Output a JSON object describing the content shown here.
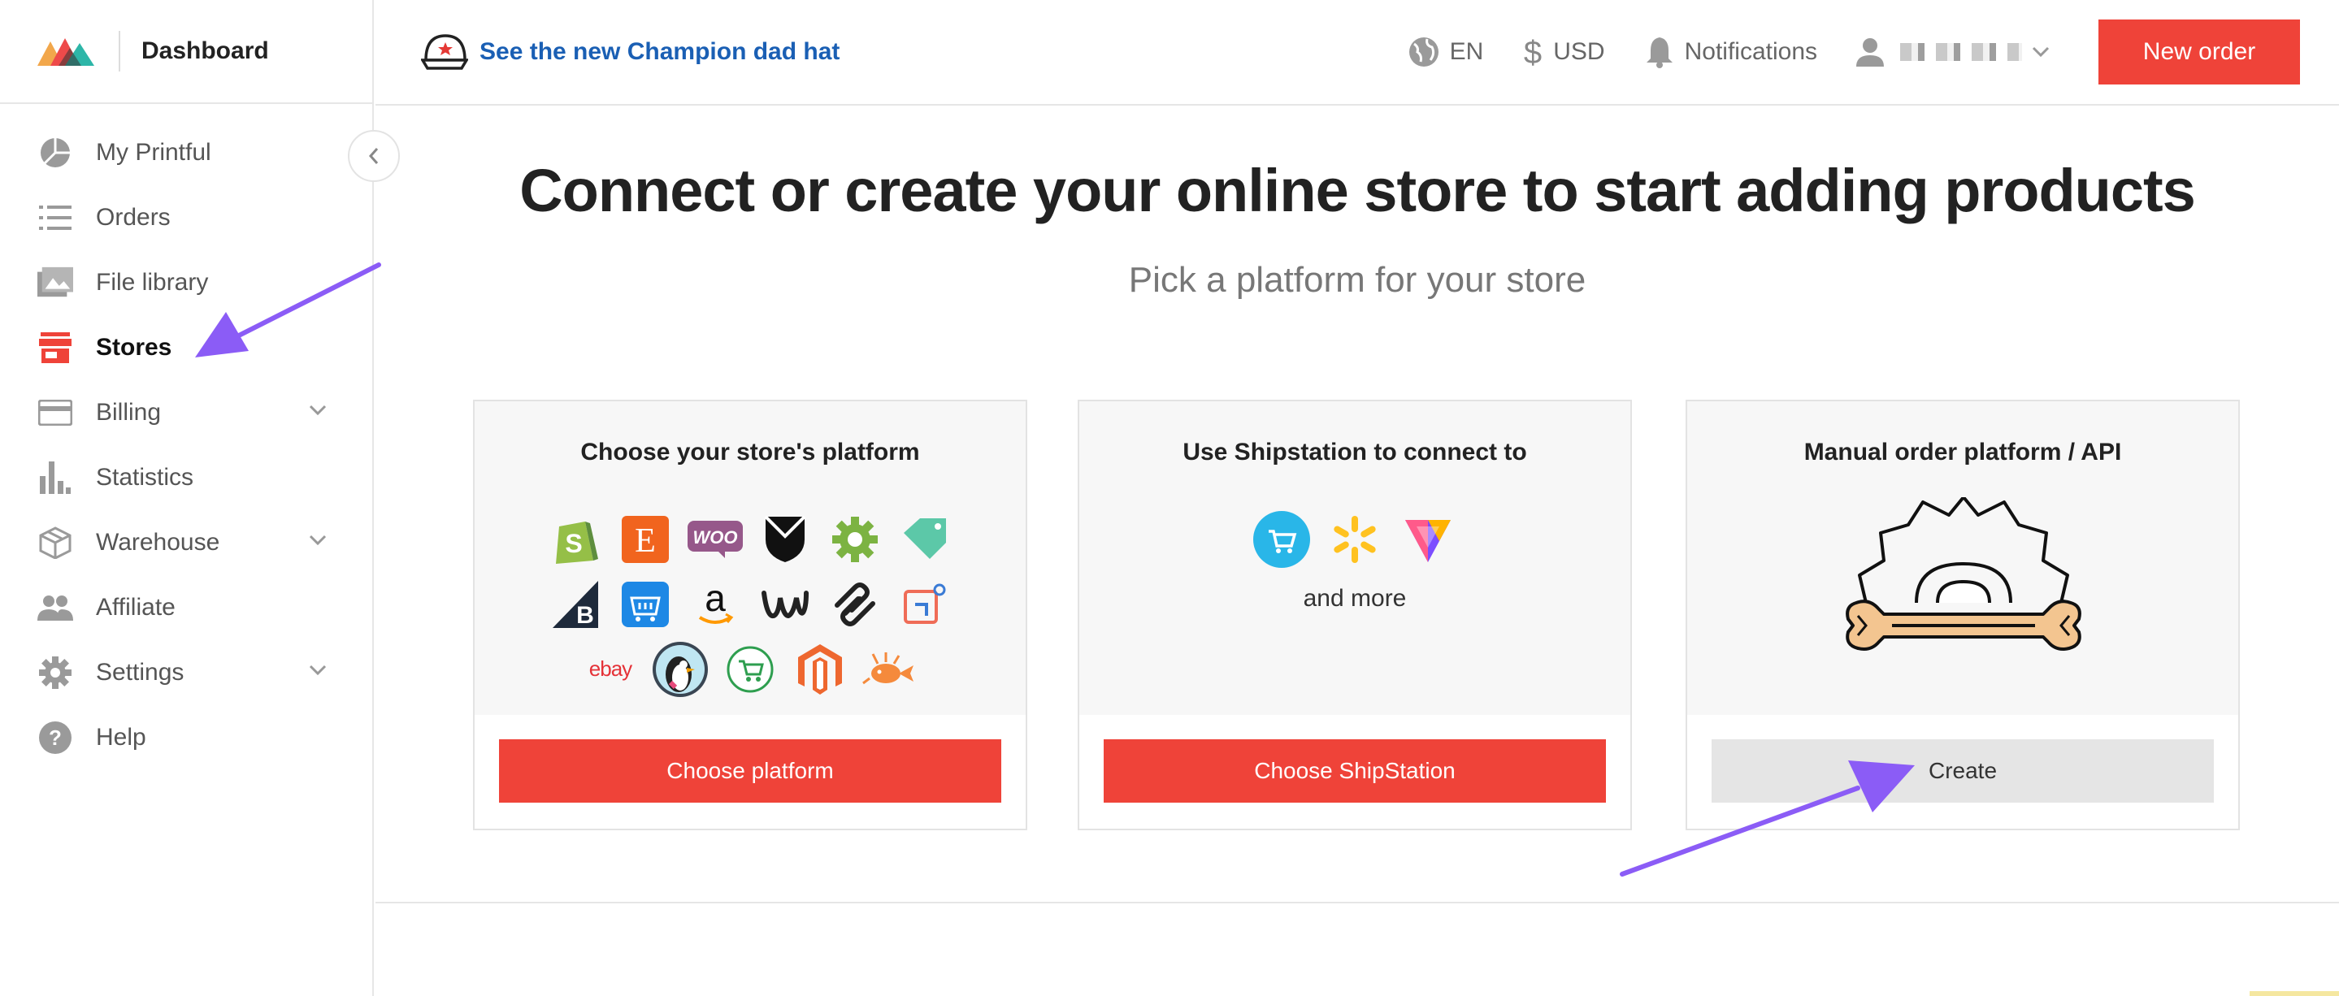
{
  "sidebar": {
    "title": "Dashboard",
    "items": [
      {
        "label": "My Printful",
        "icon": "pie-chart-icon"
      },
      {
        "label": "Orders",
        "icon": "list-icon"
      },
      {
        "label": "File library",
        "icon": "image-icon"
      },
      {
        "label": "Stores",
        "icon": "store-icon",
        "active": true
      },
      {
        "label": "Billing",
        "icon": "credit-card-icon",
        "expandable": true
      },
      {
        "label": "Statistics",
        "icon": "bar-chart-icon"
      },
      {
        "label": "Warehouse",
        "icon": "box-icon",
        "expandable": true
      },
      {
        "label": "Affiliate",
        "icon": "people-icon"
      },
      {
        "label": "Settings",
        "icon": "gear-icon",
        "expandable": true
      },
      {
        "label": "Help",
        "icon": "question-icon"
      }
    ]
  },
  "header": {
    "promo_text": "See the new Champion dad hat",
    "language": "EN",
    "currency": "USD",
    "notifications_label": "Notifications",
    "new_order_label": "New order"
  },
  "main": {
    "headline": "Connect or create your online store to start adding products",
    "subheadline": "Pick a platform for your store",
    "cards": [
      {
        "title": "Choose your store's platform",
        "button": "Choose platform"
      },
      {
        "title": "Use Shipstation to connect to",
        "extra": "and more",
        "button": "Choose ShipStation"
      },
      {
        "title": "Manual order platform / API",
        "button": "Create"
      }
    ],
    "platform_logos": [
      "shopify",
      "etsy",
      "woocommerce",
      "squarespace-shield",
      "gear-app",
      "tag-app",
      "bigcommerce",
      "shopping-basket",
      "amazon",
      "weebly",
      "squarespace",
      "wix-square",
      "ebay",
      "prestashop",
      "cart-circle",
      "magento",
      "fish-app"
    ],
    "ebay_text": "ebay",
    "woo_text": "WOO",
    "etsy_text": "E",
    "shipstation_logos": [
      "cart-circle-blue",
      "walmart-spark",
      "volusion"
    ]
  },
  "colors": {
    "accent": "#ef4339",
    "link": "#1a5fb4",
    "annotation_arrow": "#8b5cf6"
  }
}
